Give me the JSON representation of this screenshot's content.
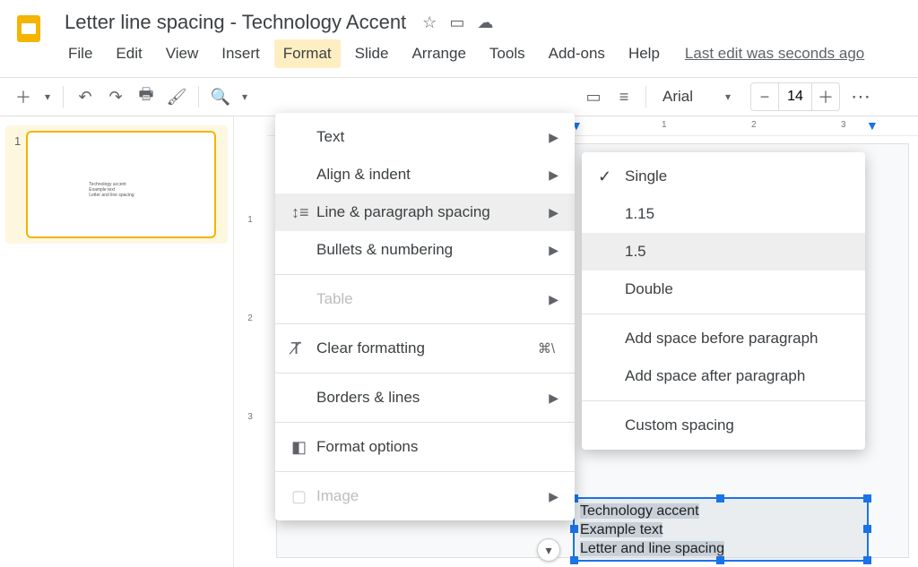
{
  "doc_title": "Letter line spacing - Technology Accent",
  "menubar": {
    "file": "File",
    "edit": "Edit",
    "view": "View",
    "insert": "Insert",
    "format": "Format",
    "slide": "Slide",
    "arrange": "Arrange",
    "tools": "Tools",
    "addons": "Add-ons",
    "help": "Help",
    "last_edit": "Last edit was seconds ago"
  },
  "toolbar": {
    "font": "Arial",
    "font_size": "14"
  },
  "ruler": {
    "h_ticks": [
      "1",
      "2",
      "3"
    ],
    "v_ticks": [
      "1",
      "2",
      "3"
    ]
  },
  "thumbnail": {
    "number": "1",
    "preview_lines": [
      "Technology accent",
      "Example text",
      "Letter and line spacing"
    ]
  },
  "format_menu": {
    "text": "Text",
    "align": "Align & indent",
    "line_spacing": "Line & paragraph spacing",
    "bullets": "Bullets & numbering",
    "table": "Table",
    "clear": "Clear formatting",
    "clear_shortcut": "⌘\\",
    "borders": "Borders & lines",
    "format_options": "Format options",
    "image": "Image"
  },
  "submenu": {
    "single": "Single",
    "v115": "1.15",
    "v15": "1.5",
    "double": "Double",
    "before": "Add space before paragraph",
    "after": "Add space after paragraph",
    "custom": "Custom spacing"
  },
  "textbox": {
    "l1": "Technology accent",
    "l2": "Example text",
    "l3": "Letter and line spacing"
  }
}
